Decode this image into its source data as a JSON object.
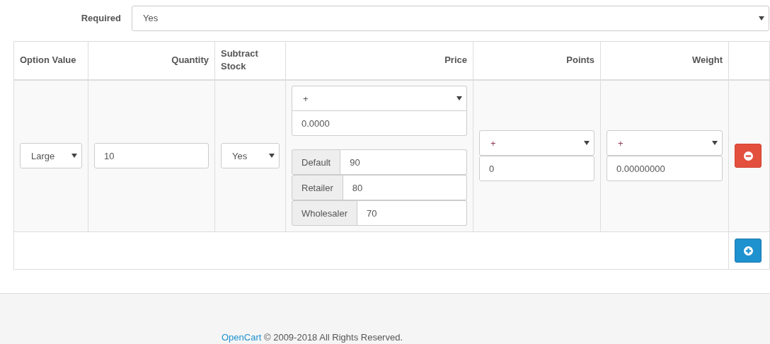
{
  "required": {
    "label": "Required",
    "value": "Yes"
  },
  "table": {
    "columns": [
      "Option Value",
      "Quantity",
      "Subtract Stock",
      "Price",
      "Points",
      "Weight"
    ],
    "rows": [
      {
        "option_value": "Large",
        "quantity": "10",
        "subtract": "Yes",
        "price_prefix": "+",
        "price": "0.0000",
        "group_prices": [
          {
            "group": "Default",
            "price": "90"
          },
          {
            "group": "Retailer",
            "price": "80"
          },
          {
            "group": "Wholesaler",
            "price": "70"
          }
        ],
        "points_prefix": "+",
        "points": "0",
        "weight_prefix": "+",
        "weight": "0.00000000"
      }
    ]
  },
  "footer": {
    "link": "OpenCart",
    "text": "© 2009-2018 All Rights Reserved."
  }
}
